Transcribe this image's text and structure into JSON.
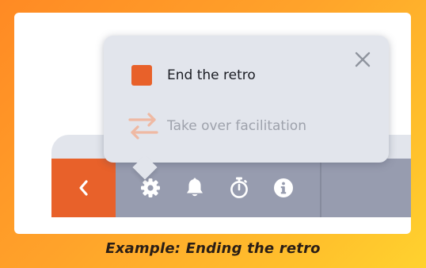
{
  "popover": {
    "items": [
      {
        "label": "End the retro",
        "icon": "stop-square-icon",
        "enabled": true
      },
      {
        "label": "Take over facilitation",
        "icon": "swap-arrows-icon",
        "enabled": false
      }
    ],
    "close_icon": "close-icon"
  },
  "toolbar": {
    "back_icon": "chevron-left-icon",
    "tools": [
      "gear-icon",
      "bell-icon",
      "stopwatch-icon",
      "info-icon"
    ]
  },
  "caption": "Example: Ending the retro",
  "colors": {
    "accent": "#e8612a",
    "toolbar": "#979caf",
    "popover_bg": "#e2e5ec",
    "frame_gradient_start": "#ff8a24",
    "frame_gradient_end": "#ffd22e"
  }
}
